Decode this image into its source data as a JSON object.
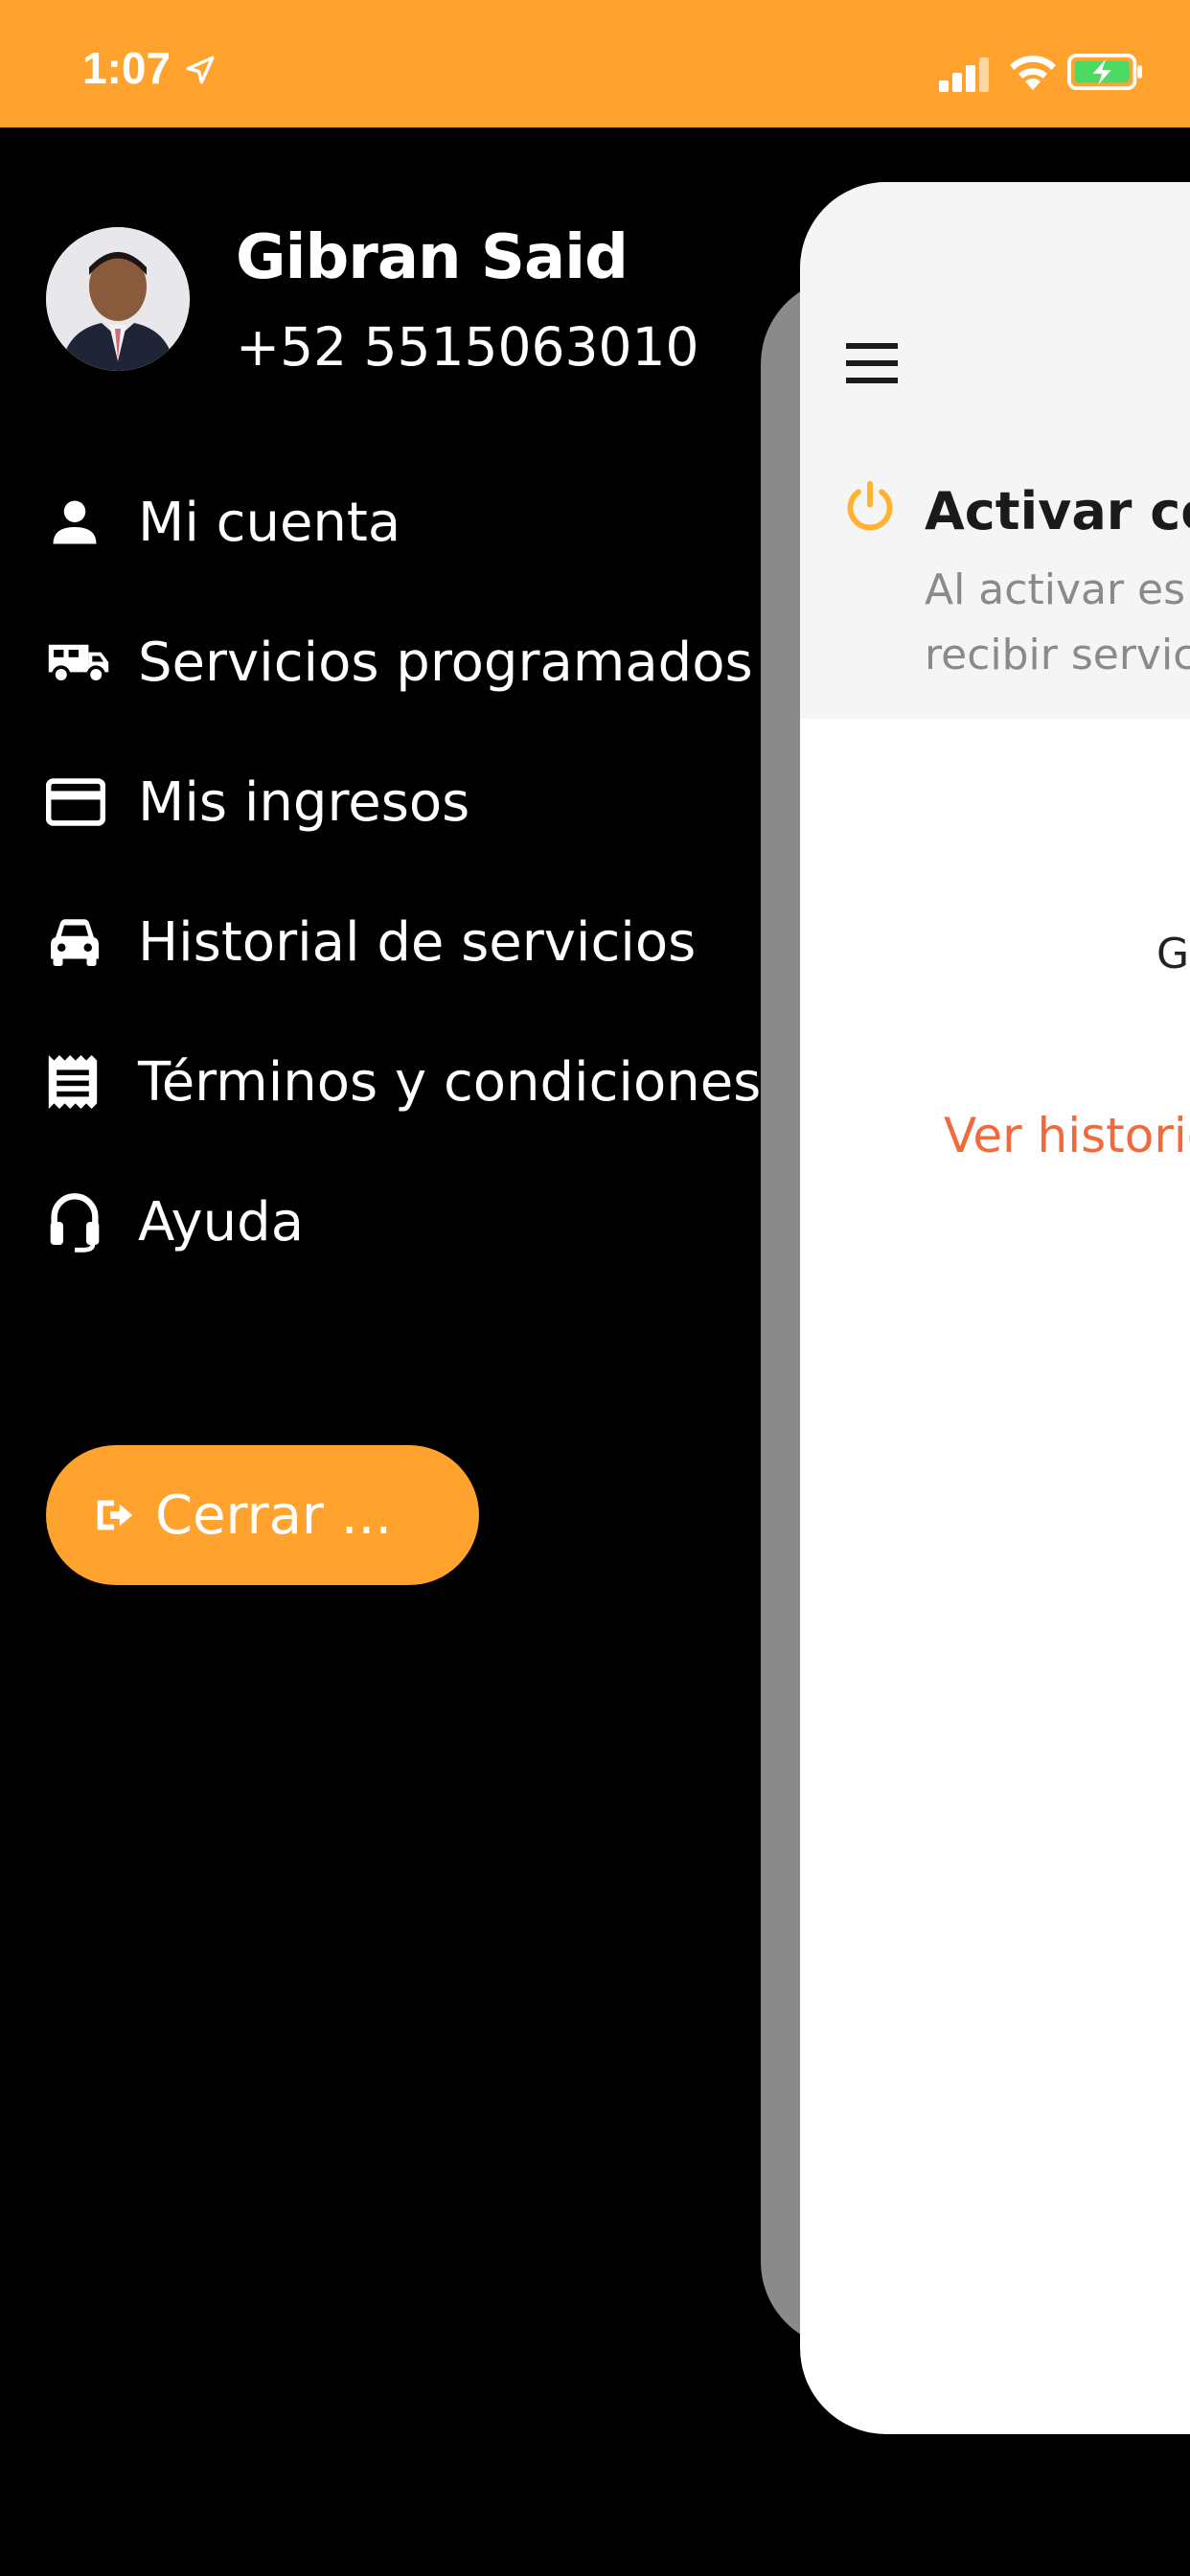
{
  "status_bar": {
    "time": "1:07",
    "icons": [
      "location-arrow-icon",
      "signal-icon",
      "wifi-icon",
      "battery-charging-icon"
    ],
    "background_color": "#FFA22E"
  },
  "profile": {
    "name": "Gibran Said",
    "phone": "+52 5515063010"
  },
  "menu": {
    "items": [
      {
        "icon": "person-icon",
        "label": "Mi cuenta"
      },
      {
        "icon": "truck-icon",
        "label": "Servicios programados"
      },
      {
        "icon": "credit-card-icon",
        "label": "Mis ingresos"
      },
      {
        "icon": "car-icon",
        "label": "Historial de servicios"
      },
      {
        "icon": "receipt-icon",
        "label": "Términos y condiciones"
      },
      {
        "icon": "headset-icon",
        "label": "Ayuda"
      }
    ]
  },
  "logout": {
    "icon": "logout-icon",
    "label": "Cerrar ..."
  },
  "main_panel": {
    "activar_title": "Activar cor",
    "activar_desc_line1": "Al activar es",
    "activar_desc_line2": "recibir servic",
    "g_text": "G",
    "history_link": "Ver historic",
    "accent_color": "#FFA22E",
    "link_color": "#F26A3C"
  }
}
